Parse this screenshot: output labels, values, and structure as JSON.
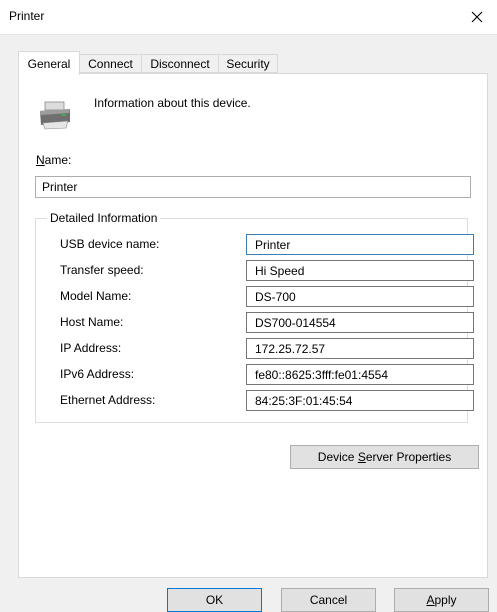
{
  "window": {
    "title": "Printer"
  },
  "tabs": [
    {
      "label": "General"
    },
    {
      "label": "Connect"
    },
    {
      "label": "Disconnect"
    },
    {
      "label": "Security"
    }
  ],
  "general": {
    "info_text": "Information about this device.",
    "name_label_underlined": "N",
    "name_label_rest": "ame:",
    "name_value": "Printer",
    "group_title": "Detailed Information",
    "details": [
      {
        "label": "USB device name:",
        "value": "Printer"
      },
      {
        "label": "Transfer speed:",
        "value": "Hi Speed"
      },
      {
        "label": "Model Name:",
        "value": "DS-700"
      },
      {
        "label": "Host Name:",
        "value": "DS700-014554"
      },
      {
        "label": "IP Address:",
        "value": "172.25.72.57"
      },
      {
        "label": "IPv6 Address:",
        "value": "fe80::8625:3fff:fe01:4554"
      },
      {
        "label": "Ethernet Address:",
        "value": "84:25:3F:01:45:54"
      }
    ],
    "server_btn_pre": "Device ",
    "server_btn_u": "S",
    "server_btn_post": "erver Properties"
  },
  "buttons": {
    "ok": "OK",
    "cancel": "Cancel",
    "apply_u": "A",
    "apply_rest": "pply"
  },
  "icons": {
    "close": "close-icon",
    "device": "printer-icon"
  }
}
